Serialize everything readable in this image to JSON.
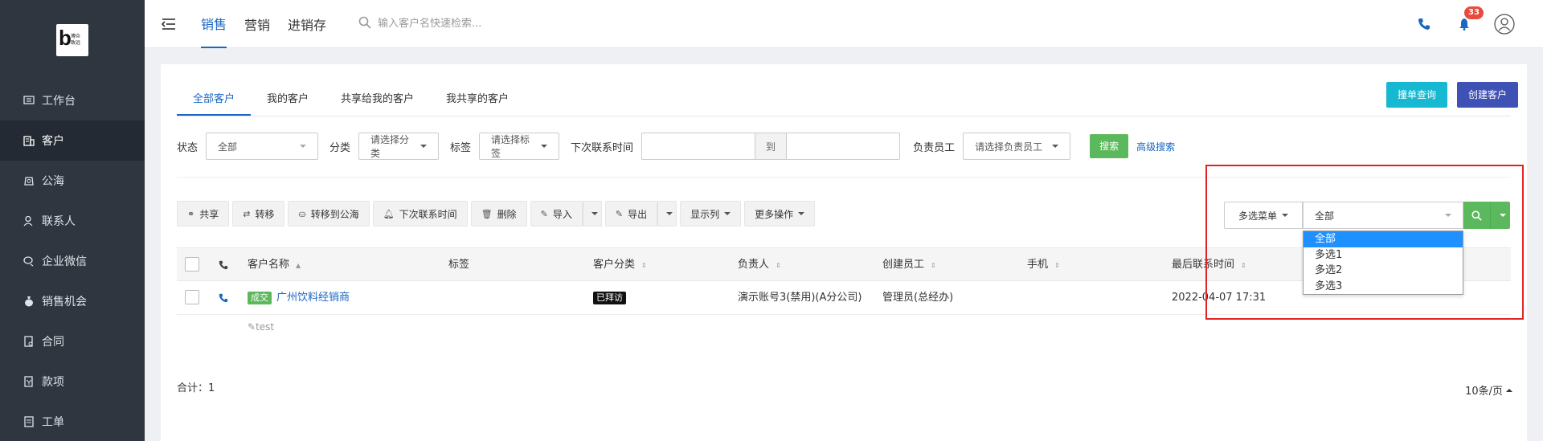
{
  "logo": {
    "letter": "b",
    "text_line1": "博众",
    "text_line2": "致远"
  },
  "sidebar": {
    "items": [
      {
        "label": "工作台",
        "icon": "dashboard-icon",
        "active": false
      },
      {
        "label": "客户",
        "icon": "building-icon",
        "active": true
      },
      {
        "label": "公海",
        "icon": "pool-icon",
        "active": false
      },
      {
        "label": "联系人",
        "icon": "contact-icon",
        "active": false
      },
      {
        "label": "企业微信",
        "icon": "wechat-icon",
        "active": false
      },
      {
        "label": "销售机会",
        "icon": "money-bag-icon",
        "active": false
      },
      {
        "label": "合同",
        "icon": "contract-icon",
        "active": false
      },
      {
        "label": "款项",
        "icon": "payment-icon",
        "active": false
      },
      {
        "label": "工单",
        "icon": "ticket-icon",
        "active": false
      }
    ]
  },
  "topbar": {
    "tabs": [
      "销售",
      "营销",
      "进销存"
    ],
    "search_placeholder": "输入客户名快速检索...",
    "notification_count": "33"
  },
  "page": {
    "tabs": [
      "全部客户",
      "我的客户",
      "共享给我的客户",
      "我共享的客户"
    ],
    "btn_query": "撞单查询",
    "btn_create": "创建客户",
    "filters": {
      "status_label": "状态",
      "status_value": "全部",
      "category_label": "分类",
      "category_value": "请选择分类",
      "tag_label": "标签",
      "tag_value": "请选择标签",
      "next_contact_label": "下次联系时间",
      "to_label": "到",
      "owner_label": "负责员工",
      "owner_value": "请选择负责员工",
      "search_btn": "搜索",
      "advanced_link": "高级搜索"
    },
    "toolbar": {
      "share": "共享",
      "transfer": "转移",
      "to_pool": "转移到公海",
      "next_contact": "下次联系时间",
      "delete": "删除",
      "import": "导入",
      "export": "导出",
      "columns": "显示列",
      "more": "更多操作"
    },
    "table": {
      "headers": [
        "客户名称",
        "标签",
        "客户分类",
        "负责人",
        "创建员工",
        "手机",
        "最后联系时间"
      ],
      "rows": [
        {
          "status_tag": "成交",
          "name": "广州饮料经销商",
          "tag": "",
          "category": "已拜访",
          "owner": "演示账号3(禁用)(A分公司)",
          "creator": "管理员(总经办)",
          "phone": "",
          "last_contact": "2022-04-07 17:31",
          "note": "test"
        }
      ]
    },
    "total_label": "合计：1",
    "page_size": "10条/页",
    "multiselect": {
      "menu_label": "多选菜单",
      "selected": "全部",
      "options": [
        "全部",
        "多选1",
        "多选2",
        "多选3"
      ]
    }
  },
  "colors": {
    "sidebar_bg": "#2f3640",
    "primary": "#1a66c2",
    "green": "#5cb85c",
    "cyan": "#17b8d1",
    "indigo": "#3f51b5",
    "highlight_border": "#e02424",
    "option_selected": "#1e90ff"
  }
}
